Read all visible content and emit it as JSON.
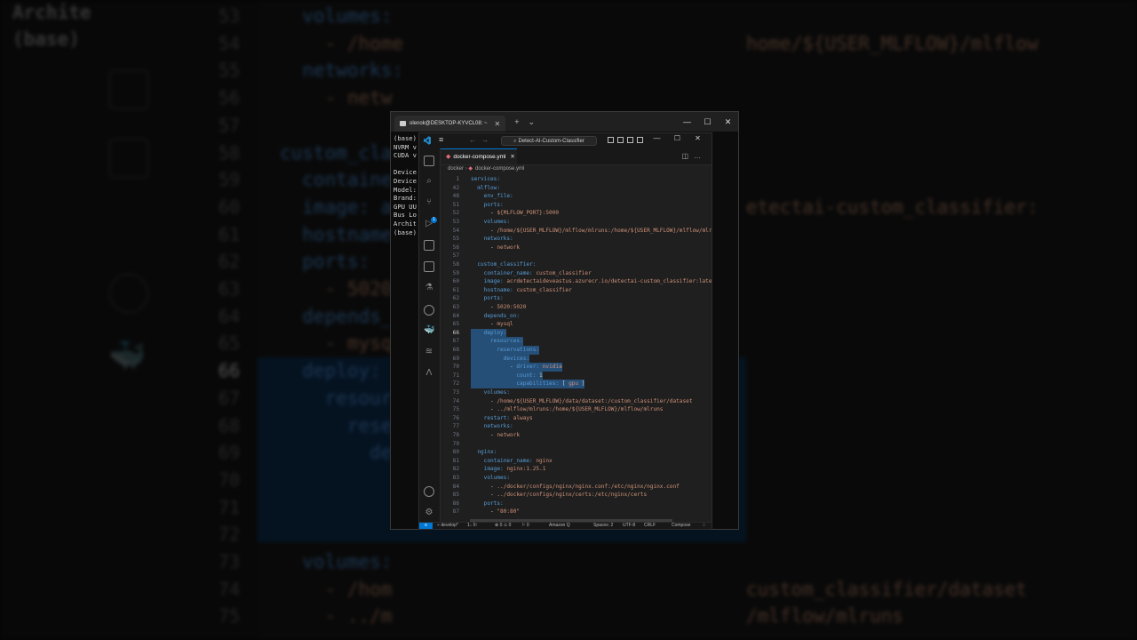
{
  "terminal": {
    "tab_title": "olenok@DESKTOP-KYVCL08: ~",
    "output_lines": [
      "(base) ",
      "NVRM v",
      "CUDA v",
      "",
      "Device",
      "Device",
      "Model:",
      "Brand:",
      "GPU UU",
      "Bus Lo",
      "Archit",
      "(base)"
    ]
  },
  "vscode": {
    "search_text": "Detect-AI-Custom-Classifier",
    "tab_name": "docker-compose.yml",
    "breadcrumb": {
      "folder": "docker",
      "file": "docker-compose.yml"
    },
    "scm_badge": "1",
    "status": {
      "branch": "develop*",
      "sync": "1↓ 0↑",
      "problems": "⊗ 0 ⚠ 0",
      "ports": "⚐ 0",
      "amazon": "Amazon Q",
      "spaces": "Spaces: 2",
      "encoding": "UTF-8",
      "eol": "CRLF",
      "language": "Compose"
    },
    "lines": [
      {
        "n": "1",
        "t": [
          [
            "k",
            "services:"
          ]
        ]
      },
      {
        "n": "42",
        "t": [
          [
            "k",
            "  mlflow:"
          ]
        ]
      },
      {
        "n": "48",
        "t": [
          [
            "k",
            "    env_file:"
          ]
        ]
      },
      {
        "n": "51",
        "t": [
          [
            "k",
            "    ports:"
          ]
        ]
      },
      {
        "n": "52",
        "t": [
          [
            "p",
            "      - "
          ],
          [
            "s",
            "${MLFLOW_PORT}:5000"
          ]
        ]
      },
      {
        "n": "53",
        "t": [
          [
            "k",
            "    volumes:"
          ]
        ]
      },
      {
        "n": "54",
        "t": [
          [
            "p",
            "      - "
          ],
          [
            "s",
            "/home/${USER_MLFLOW}/mlflow/mlruns:/home/${USER_MLFLOW}/mlflow/mlruns"
          ]
        ]
      },
      {
        "n": "55",
        "t": [
          [
            "k",
            "    networks:"
          ]
        ]
      },
      {
        "n": "56",
        "t": [
          [
            "p",
            "      - "
          ],
          [
            "s",
            "network"
          ]
        ]
      },
      {
        "n": "57",
        "t": []
      },
      {
        "n": "58",
        "t": [
          [
            "k",
            "  custom_classifier:"
          ]
        ]
      },
      {
        "n": "59",
        "t": [
          [
            "k",
            "    container_name: "
          ],
          [
            "s",
            "custom_classifier"
          ]
        ]
      },
      {
        "n": "60",
        "t": [
          [
            "k",
            "    image: "
          ],
          [
            "s",
            "acrdetectaideveastus.azurecr.io/detectai-custom_classifier:latest"
          ]
        ]
      },
      {
        "n": "61",
        "t": [
          [
            "k",
            "    hostname: "
          ],
          [
            "s",
            "custom_classifier"
          ]
        ]
      },
      {
        "n": "62",
        "t": [
          [
            "k",
            "    ports:"
          ]
        ]
      },
      {
        "n": "63",
        "t": [
          [
            "p",
            "      - "
          ],
          [
            "s",
            "5020:5020"
          ]
        ]
      },
      {
        "n": "64",
        "t": [
          [
            "k",
            "    depends_on:"
          ]
        ]
      },
      {
        "n": "65",
        "t": [
          [
            "p",
            "      - "
          ],
          [
            "s",
            "mysql"
          ]
        ]
      },
      {
        "n": "66",
        "t": [
          [
            "k",
            "    deploy:"
          ]
        ]
      },
      {
        "n": "67",
        "t": [
          [
            "k",
            "      resources:"
          ]
        ]
      },
      {
        "n": "68",
        "t": [
          [
            "k",
            "        reservations:"
          ]
        ]
      },
      {
        "n": "69",
        "t": [
          [
            "k",
            "          devices:"
          ]
        ]
      },
      {
        "n": "70",
        "t": [
          [
            "p",
            "            - "
          ],
          [
            "k",
            "driver: "
          ],
          [
            "s",
            "nvidia"
          ]
        ]
      },
      {
        "n": "71",
        "t": [
          [
            "k",
            "              count: "
          ],
          [
            "n",
            "1"
          ]
        ]
      },
      {
        "n": "72",
        "t": [
          [
            "k",
            "              capabilities: "
          ],
          [
            "p",
            "[ "
          ],
          [
            "s",
            "gpu"
          ],
          [
            "p",
            " ]"
          ]
        ]
      },
      {
        "n": "73",
        "t": [
          [
            "k",
            "    volumes:"
          ]
        ]
      },
      {
        "n": "74",
        "t": [
          [
            "p",
            "      - "
          ],
          [
            "s",
            "/home/${USER_MLFLOW}/data/dataset:/custom_classifier/dataset"
          ]
        ]
      },
      {
        "n": "75",
        "t": [
          [
            "p",
            "      - "
          ],
          [
            "s",
            "../mlflow/mlruns:/home/${USER_MLFLOW}/mlflow/mlruns"
          ]
        ]
      },
      {
        "n": "76",
        "t": [
          [
            "k",
            "    restart: "
          ],
          [
            "s",
            "always"
          ]
        ]
      },
      {
        "n": "77",
        "t": [
          [
            "k",
            "    networks:"
          ]
        ]
      },
      {
        "n": "78",
        "t": [
          [
            "p",
            "      - "
          ],
          [
            "s",
            "network"
          ]
        ]
      },
      {
        "n": "79",
        "t": []
      },
      {
        "n": "80",
        "t": [
          [
            "k",
            "  nginx:"
          ]
        ]
      },
      {
        "n": "81",
        "t": [
          [
            "k",
            "    container_name: "
          ],
          [
            "s",
            "nginx"
          ]
        ]
      },
      {
        "n": "82",
        "t": [
          [
            "k",
            "    image: "
          ],
          [
            "s",
            "nginx:1.25.1"
          ]
        ]
      },
      {
        "n": "83",
        "t": [
          [
            "k",
            "    volumes:"
          ]
        ]
      },
      {
        "n": "84",
        "t": [
          [
            "p",
            "      - "
          ],
          [
            "s",
            "../docker/configs/nginx/nginx.conf:/etc/nginx/nginx.conf"
          ]
        ]
      },
      {
        "n": "85",
        "t": [
          [
            "p",
            "      - "
          ],
          [
            "s",
            "../docker/configs/nginx/certs:/etc/nginx/certs"
          ]
        ]
      },
      {
        "n": "86",
        "t": [
          [
            "k",
            "    ports:"
          ]
        ]
      },
      {
        "n": "87",
        "t": [
          [
            "p",
            "      - "
          ],
          [
            "s",
            "\"80:80\""
          ]
        ]
      }
    ],
    "selected_lines": [
      "66",
      "67",
      "68",
      "69",
      "70",
      "71",
      "72"
    ],
    "current_line": "66"
  },
  "background": {
    "left_text": [
      "Archite",
      "(base)"
    ],
    "line_numbers": [
      "53",
      "54",
      "55",
      "56",
      "57",
      "58",
      "59",
      "60",
      "61",
      "62",
      "63",
      "64",
      "65",
      "66",
      "67",
      "68",
      "69",
      "70",
      "71",
      "72",
      "73",
      "74",
      "75"
    ],
    "code": [
      [
        "k",
        "  volumes:"
      ],
      [
        "s",
        "    - /home"
      ],
      [
        "k",
        "  networks:"
      ],
      [
        "s",
        "    - netw"
      ],
      [
        "p",
        ""
      ],
      [
        "k",
        "custom_cla"
      ],
      [
        "k",
        "  containe"
      ],
      [
        "k",
        "  image: a"
      ],
      [
        "k",
        "  hostname"
      ],
      [
        "k",
        "  ports:"
      ],
      [
        "s",
        "    - 5020"
      ],
      [
        "k",
        "  depends_"
      ],
      [
        "s",
        "    - mysq"
      ],
      [
        "k",
        "  deploy:"
      ],
      [
        "k",
        "    resour"
      ],
      [
        "k",
        "      rese"
      ],
      [
        "k",
        "        de"
      ],
      [
        "p",
        ""
      ],
      [
        "p",
        ""
      ],
      [
        "p",
        ""
      ],
      [
        "k",
        "  volumes:"
      ],
      [
        "s",
        "    - /hom"
      ],
      [
        "s",
        "    - ../m"
      ]
    ],
    "right_text": [
      {
        "row": 1,
        "text": "home/${USER_MLFLOW}/mlflow"
      },
      {
        "row": 7,
        "text": "etectai-custom_classifier:"
      },
      {
        "row": 21,
        "text": "custom_classifier/dataset"
      },
      {
        "row": 22,
        "text": "/mlflow/mlruns"
      }
    ]
  }
}
